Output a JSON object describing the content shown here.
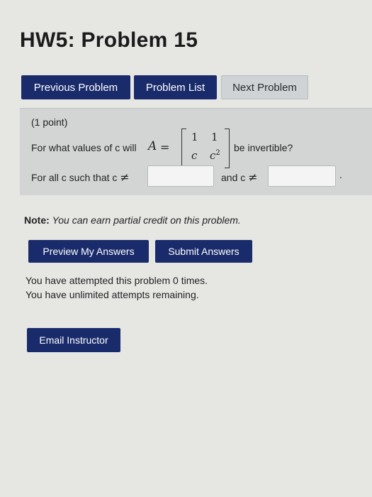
{
  "header": {
    "title": "HW5: Problem 15"
  },
  "nav": {
    "previous_label": "Previous Problem",
    "list_label": "Problem List",
    "next_label": "Next Problem"
  },
  "problem": {
    "points": "(1 point)",
    "question_prefix": "For what values of c will",
    "matrix_var": "A",
    "equals": "=",
    "matrix": {
      "r1c1": "1",
      "r1c2": "1",
      "r2c1": "c",
      "r2c2": "c",
      "r2c2_exp": "2"
    },
    "question_suffix": "be invertible?",
    "for_all_label": "For all c such that c",
    "neq_symbol": "≠",
    "and_label": "and c",
    "period": ".",
    "answer1_value": "",
    "answer2_value": ""
  },
  "note": {
    "label": "Note:",
    "text": "You can earn partial credit on this problem."
  },
  "actions": {
    "preview_label": "Preview My Answers",
    "submit_label": "Submit Answers"
  },
  "status": {
    "attempts": "You have attempted this problem 0 times.",
    "remaining": "You have unlimited attempts remaining."
  },
  "email": {
    "label": "Email Instructor"
  }
}
